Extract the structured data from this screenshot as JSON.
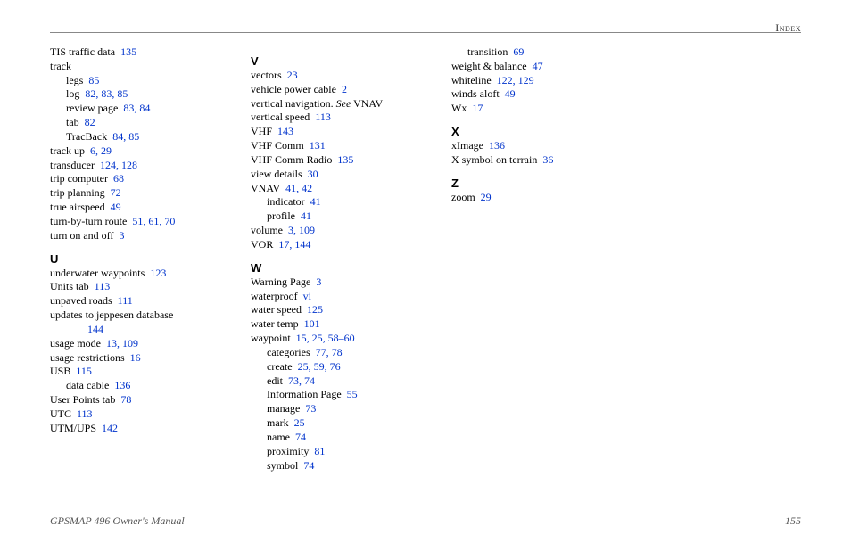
{
  "header": "Index",
  "footer_left": "GPSMAP 496 Owner's Manual",
  "footer_right": "155",
  "columns": [
    {
      "entries": [
        {
          "text": "TIS traffic data",
          "pages": [
            "135"
          ]
        },
        {
          "text": "track"
        },
        {
          "text": "legs",
          "pages": [
            "85"
          ],
          "indent": 1
        },
        {
          "text": "log",
          "pages": [
            "82",
            "83",
            "85"
          ],
          "indent": 1
        },
        {
          "text": "review page",
          "pages": [
            "83",
            "84"
          ],
          "indent": 1
        },
        {
          "text": "tab",
          "pages": [
            "82"
          ],
          "indent": 1
        },
        {
          "text": "TracBack",
          "pages": [
            "84",
            "85"
          ],
          "indent": 1
        },
        {
          "text": "track up",
          "pages": [
            "6",
            "29"
          ]
        },
        {
          "text": "transducer",
          "pages": [
            "124",
            "128"
          ]
        },
        {
          "text": "trip computer",
          "pages": [
            "68"
          ]
        },
        {
          "text": "trip planning",
          "pages": [
            "72"
          ]
        },
        {
          "text": "true airspeed",
          "pages": [
            "49"
          ]
        },
        {
          "text": "turn-by-turn route",
          "pages": [
            "51",
            "61",
            "70"
          ]
        },
        {
          "text": "turn on and off",
          "pages": [
            "3"
          ]
        },
        {
          "letter": "U"
        },
        {
          "text": "underwater waypoints",
          "pages": [
            "123"
          ]
        },
        {
          "text": "Units tab",
          "pages": [
            "113"
          ]
        },
        {
          "text": "unpaved roads",
          "pages": [
            "111"
          ]
        },
        {
          "text": "updates to jeppesen database",
          "pages_tail": [
            "144"
          ],
          "wrap": true
        },
        {
          "text": "usage mode",
          "pages": [
            "13",
            "109"
          ]
        },
        {
          "text": "usage restrictions",
          "pages": [
            "16"
          ]
        },
        {
          "text": "USB",
          "pages": [
            "115"
          ]
        },
        {
          "text": "data cable",
          "pages": [
            "136"
          ],
          "indent": 1
        },
        {
          "text": "User Points tab",
          "pages": [
            "78"
          ]
        },
        {
          "text": "UTC",
          "pages": [
            "113"
          ]
        },
        {
          "text": "UTM/UPS",
          "pages": [
            "142"
          ]
        }
      ]
    },
    {
      "entries": [
        {
          "letter": "V"
        },
        {
          "text": "vectors",
          "pages": [
            "23"
          ]
        },
        {
          "text": "vehicle power cable",
          "pages": [
            "2"
          ]
        },
        {
          "text": "vertical navigation.",
          "see": "See",
          "see_target": "VNAV"
        },
        {
          "text": "vertical speed",
          "pages": [
            "113"
          ]
        },
        {
          "text": "VHF",
          "pages": [
            "143"
          ]
        },
        {
          "text": "VHF Comm",
          "pages": [
            "131"
          ]
        },
        {
          "text": "VHF Comm Radio",
          "pages": [
            "135"
          ]
        },
        {
          "text": "view details",
          "pages": [
            "30"
          ]
        },
        {
          "text": "VNAV",
          "pages": [
            "41",
            "42"
          ]
        },
        {
          "text": "indicator",
          "pages": [
            "41"
          ],
          "indent": 1
        },
        {
          "text": "profile",
          "pages": [
            "41"
          ],
          "indent": 1
        },
        {
          "text": "volume",
          "pages": [
            "3",
            "109"
          ]
        },
        {
          "text": "VOR",
          "pages": [
            "17",
            "144"
          ]
        },
        {
          "letter": "W"
        },
        {
          "text": "Warning Page",
          "pages": [
            "3"
          ]
        },
        {
          "text": "waterproof",
          "pages": [
            "vi"
          ]
        },
        {
          "text": "water speed",
          "pages": [
            "125"
          ]
        },
        {
          "text": "water temp",
          "pages": [
            "101"
          ]
        },
        {
          "text": "waypoint",
          "pages": [
            "15",
            "25",
            "58–60"
          ]
        },
        {
          "text": "categories",
          "pages": [
            "77",
            "78"
          ],
          "indent": 1
        },
        {
          "text": "create",
          "pages": [
            "25",
            "59",
            "76"
          ],
          "indent": 1
        },
        {
          "text": "edit",
          "pages": [
            "73",
            "74"
          ],
          "indent": 1
        },
        {
          "text": "Information Page",
          "pages": [
            "55"
          ],
          "indent": 1
        },
        {
          "text": "manage",
          "pages": [
            "73"
          ],
          "indent": 1
        },
        {
          "text": "mark",
          "pages": [
            "25"
          ],
          "indent": 1
        },
        {
          "text": "name",
          "pages": [
            "74"
          ],
          "indent": 1
        },
        {
          "text": "proximity",
          "pages": [
            "81"
          ],
          "indent": 1
        },
        {
          "text": "symbol",
          "pages": [
            "74"
          ],
          "indent": 1
        }
      ]
    },
    {
      "entries": [
        {
          "text": "transition",
          "pages": [
            "69"
          ],
          "indent": 1
        },
        {
          "text": "weight & balance",
          "pages": [
            "47"
          ]
        },
        {
          "text": "whiteline",
          "pages": [
            "122",
            "129"
          ]
        },
        {
          "text": "winds aloft",
          "pages": [
            "49"
          ]
        },
        {
          "text": "Wx",
          "pages": [
            "17"
          ]
        },
        {
          "letter": "X"
        },
        {
          "text": "xImage",
          "pages": [
            "136"
          ]
        },
        {
          "text": "X symbol on terrain",
          "pages": [
            "36"
          ]
        },
        {
          "letter": "Z"
        },
        {
          "text": "zoom",
          "pages": [
            "29"
          ]
        }
      ]
    }
  ]
}
